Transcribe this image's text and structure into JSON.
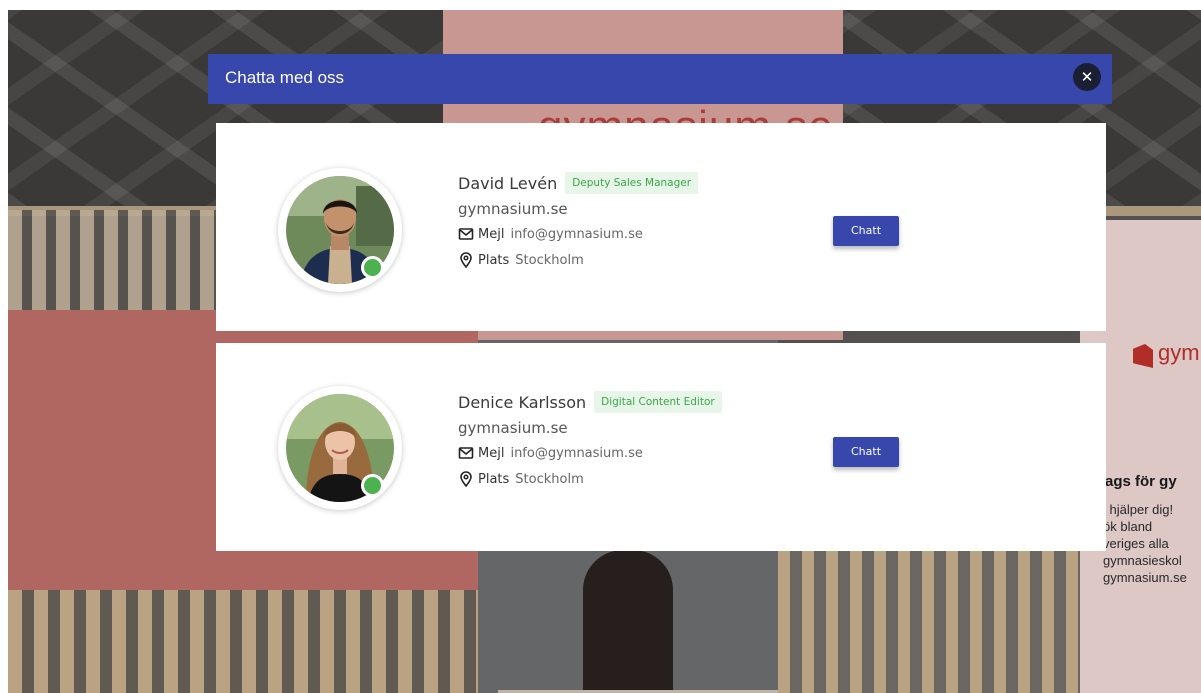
{
  "modal": {
    "title": "Chatta med oss",
    "close_icon": "close-icon"
  },
  "contacts": [
    {
      "name": "David Levén",
      "role": "Deputy Sales Manager",
      "company": "gymnasium.se",
      "email_label": "Mejl",
      "email": "info@gymnasium.se",
      "location_label": "Plats",
      "location": "Stockholm",
      "chat_label": "Chatt",
      "status": "online"
    },
    {
      "name": "Denice Karlsson",
      "role": "Digital Content Editor",
      "company": "gymnasium.se",
      "email_label": "Mejl",
      "email": "info@gymnasium.se",
      "location_label": "Plats",
      "location": "Stockholm",
      "chat_label": "Chatt",
      "status": "online"
    }
  ],
  "background": {
    "brand_center": "gymnasium.se",
    "brand_right": "gymn",
    "right_heading": "ags för gy",
    "right_lines": [
      "i hjälper dig!",
      "ök bland",
      "veriges alla",
      "gymnasieskol",
      "gymnasium.se"
    ]
  },
  "colors": {
    "header": "#3747ab",
    "button": "#3747ab",
    "online": "#4cb24f",
    "badge_text": "#3aa746",
    "badge_bg": "#e8f6e9"
  }
}
